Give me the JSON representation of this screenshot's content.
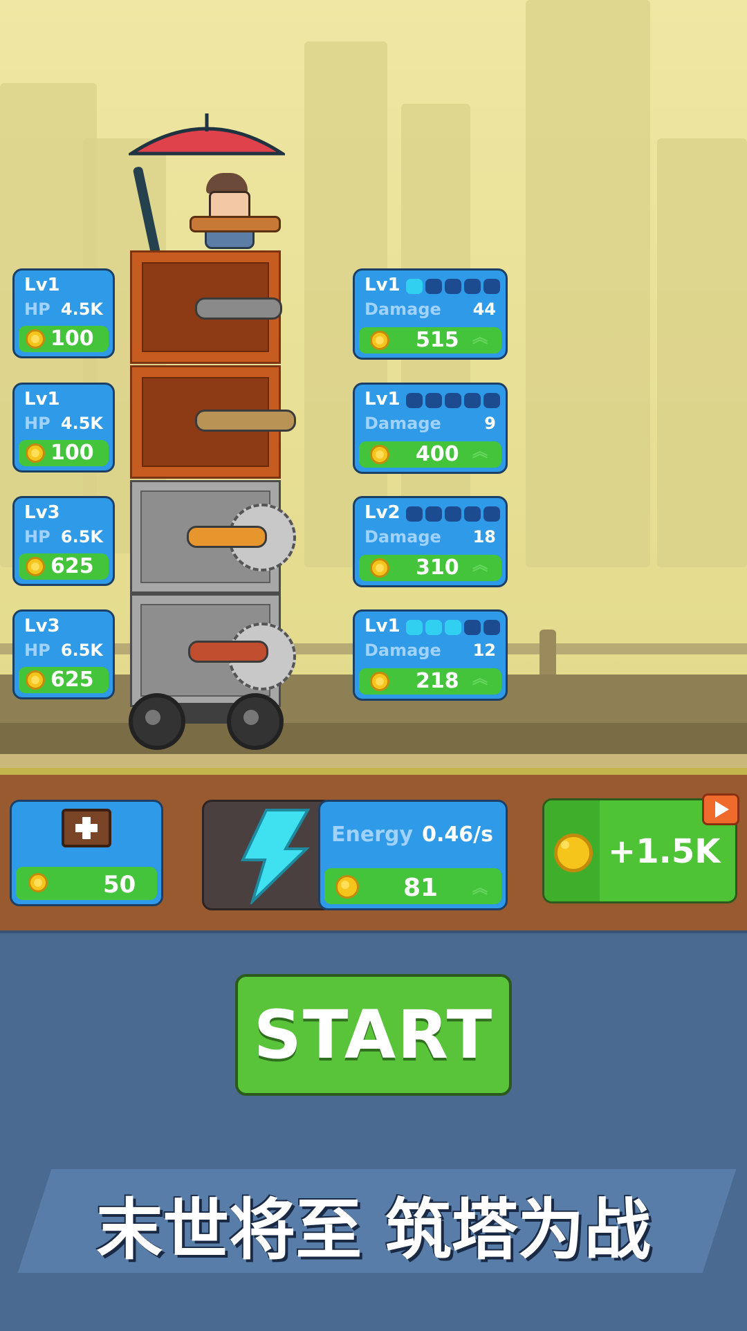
{
  "colors": {
    "card_blue": "#2f9ae8",
    "card_border": "#1c3f66",
    "cost_green": "#44c43b",
    "start_green": "#59c43a",
    "lower_bg": "#4b6a92",
    "dirt": "#9a5a30"
  },
  "left_cards": [
    {
      "lv": "Lv1",
      "hp_label": "HP",
      "hp": "4.5K",
      "cost": "100"
    },
    {
      "lv": "Lv1",
      "hp_label": "HP",
      "hp": "4.5K",
      "cost": "100"
    },
    {
      "lv": "Lv3",
      "hp_label": "HP",
      "hp": "6.5K",
      "cost": "625"
    },
    {
      "lv": "Lv3",
      "hp_label": "HP",
      "hp": "6.5K",
      "cost": "625"
    }
  ],
  "right_cards": [
    {
      "lv": "Lv1",
      "dmg_label": "Damage",
      "damage": "44",
      "cost": "515",
      "pips_filled": 1
    },
    {
      "lv": "Lv1",
      "dmg_label": "Damage",
      "damage": "9",
      "cost": "400",
      "pips_filled": 0
    },
    {
      "lv": "Lv2",
      "dmg_label": "Damage",
      "damage": "18",
      "cost": "310",
      "pips_filled": 0
    },
    {
      "lv": "Lv1",
      "dmg_label": "Damage",
      "damage": "12",
      "cost": "218",
      "pips_filled": 3
    }
  ],
  "crate_buy": {
    "icon": "crate-plus-icon",
    "cost": "50"
  },
  "energy": {
    "icon": "lightning-icon",
    "label": "Energy",
    "rate": "0.46/s",
    "cost": "81"
  },
  "coin_bonus": {
    "label": "+1.5K",
    "icon": "video-ad-icon"
  },
  "start_label": "START",
  "slogan": "末世将至  筑塔为战"
}
